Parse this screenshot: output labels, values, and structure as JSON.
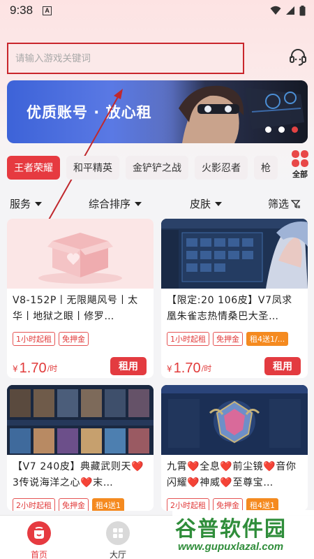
{
  "status_bar": {
    "time": "9:38",
    "notification_icon": "A"
  },
  "search": {
    "placeholder": "请输入游戏关键词"
  },
  "banner": {
    "text": "优质账号 · 放心租"
  },
  "categories": [
    "王者荣耀",
    "和平精英",
    "金铲铲之战",
    "火影忍者",
    "枪"
  ],
  "categories_all_label": "全部",
  "filters": {
    "service": "服务",
    "sort": "综合排序",
    "skin": "皮肤",
    "filter": "筛选"
  },
  "listings": [
    {
      "title": "V8-152P丨无限飓风号丨太华丨地狱之眼丨修罗…",
      "tags": [
        "1小时起租",
        "免押金"
      ],
      "price_prefix": "¥",
      "price": "1.70",
      "price_unit": "/时",
      "button": "租用"
    },
    {
      "title": "【限定:20 106皮】V7凤求凰朱雀志热情桑巴大圣…",
      "tags": [
        "1小时起租",
        "免押金",
        "租4送1/..."
      ],
      "price_prefix": "¥",
      "price": "1.70",
      "price_unit": "/时",
      "button": "租用"
    },
    {
      "title": "【V7 240皮】典藏武则天❤️3传说海洋之心❤️末…",
      "tags": [
        "2小时起租",
        "免押金",
        "租4送1"
      ]
    },
    {
      "title": "九霄❤️全息❤️前尘镜❤️音你闪耀❤️神威❤️至尊宝…",
      "tags": [
        "2小时起租",
        "免押金",
        "租4送1"
      ]
    }
  ],
  "bottom_nav": {
    "home": "首页",
    "hall": "大厅"
  },
  "watermark": {
    "main": "谷普软件园",
    "sub": "www.gupuxlazal.com"
  },
  "colors": {
    "accent": "#e33b40",
    "tag_orange": "#f58a1f",
    "annotation": "#c9262c"
  }
}
